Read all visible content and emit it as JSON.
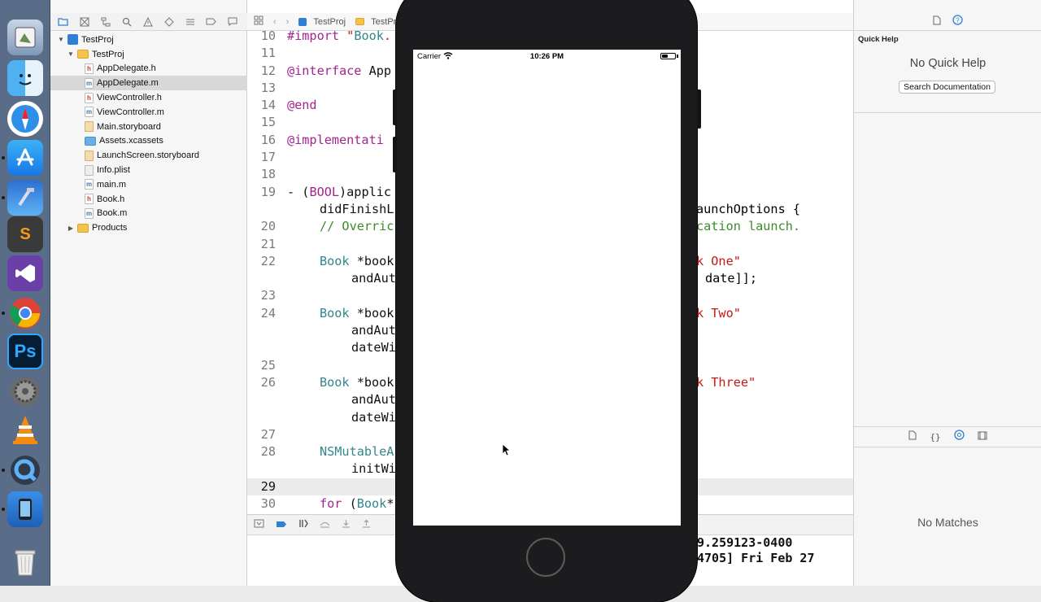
{
  "navigator": {
    "items": [
      {
        "label": "TestProj",
        "kind": "project",
        "indent": 0,
        "disclosure": "▼"
      },
      {
        "label": "TestProj",
        "kind": "folder",
        "indent": 1,
        "disclosure": "▼"
      },
      {
        "label": "AppDelegate.h",
        "kind": "h",
        "indent": 2
      },
      {
        "label": "AppDelegate.m",
        "kind": "m",
        "indent": 2,
        "selected": true
      },
      {
        "label": "ViewController.h",
        "kind": "h",
        "indent": 2
      },
      {
        "label": "ViewController.m",
        "kind": "m",
        "indent": 2
      },
      {
        "label": "Main.storyboard",
        "kind": "storyboard",
        "indent": 2
      },
      {
        "label": "Assets.xcassets",
        "kind": "assets",
        "indent": 2
      },
      {
        "label": "LaunchScreen.storyboard",
        "kind": "storyboard",
        "indent": 2
      },
      {
        "label": "Info.plist",
        "kind": "plist",
        "indent": 2
      },
      {
        "label": "main.m",
        "kind": "m",
        "indent": 2
      },
      {
        "label": "Book.h",
        "kind": "h",
        "indent": 2
      },
      {
        "label": "Book.m",
        "kind": "m",
        "indent": 2
      },
      {
        "label": "Products",
        "kind": "folder",
        "indent": 1,
        "disclosure": "▶"
      }
    ]
  },
  "jump_bar": {
    "project": "TestProj",
    "folder": "TestPr"
  },
  "code_lines": [
    {
      "n": "10",
      "t": "#import \"Book."
    },
    {
      "n": "11",
      "t": ""
    },
    {
      "n": "12",
      "t": "@interface App"
    },
    {
      "n": "13",
      "t": ""
    },
    {
      "n": "14",
      "t": "@end"
    },
    {
      "n": "15",
      "t": ""
    },
    {
      "n": "16",
      "t": "@implementati"
    },
    {
      "n": "17",
      "t": ""
    },
    {
      "n": "18",
      "t": ""
    },
    {
      "n": "19",
      "t": "- (BOOL)applic"
    },
    {
      "n": "",
      "t": "didFinishL",
      "r": "aunchOptions {"
    },
    {
      "n": "20",
      "t": "// Overric",
      "r": "cation launch."
    },
    {
      "n": "21",
      "t": ""
    },
    {
      "n": "22",
      "t": "Book *book",
      "r": "k One\""
    },
    {
      "n": "",
      "t": "andAut",
      "r": "date]];"
    },
    {
      "n": "23",
      "t": ""
    },
    {
      "n": "24",
      "t": "Book *book",
      "r": "k Two\""
    },
    {
      "n": "",
      "t": "andAut"
    },
    {
      "n": "",
      "t": "dateWi"
    },
    {
      "n": "25",
      "t": ""
    },
    {
      "n": "26",
      "t": "Book *book",
      "r": "k Three\""
    },
    {
      "n": "",
      "t": "andAut"
    },
    {
      "n": "",
      "t": "dateWi"
    },
    {
      "n": "27",
      "t": ""
    },
    {
      "n": "28",
      "t": "NSMutableA"
    },
    {
      "n": "",
      "t": "initWi"
    },
    {
      "n": "29",
      "t": ""
    },
    {
      "n": "30",
      "t": "for (Book*"
    }
  ],
  "console": {
    "line1": "9.259123-0400",
    "line2": "4705] Fri Feb 27"
  },
  "inspector": {
    "title": "Quick Help",
    "no_help": "No Quick Help",
    "search_button": "Search Documentation",
    "no_matches": "No Matches"
  },
  "simulator": {
    "carrier": "Carrier",
    "time": "10:26 PM",
    "battery_level": 0.45
  },
  "dock": {
    "apps": [
      "Preview",
      "Finder",
      "Safari",
      "App Store",
      "Xcode",
      "Sublime Text",
      "Visual Studio",
      "Chrome",
      "Photoshop",
      "System Preferences",
      "VLC",
      "QuickTime Player",
      "Simulator",
      "Trash"
    ]
  },
  "colors": {
    "keyword": "#a2258f",
    "type": "#34858c",
    "string": "#c41a16",
    "comment": "#3d8b2a"
  }
}
